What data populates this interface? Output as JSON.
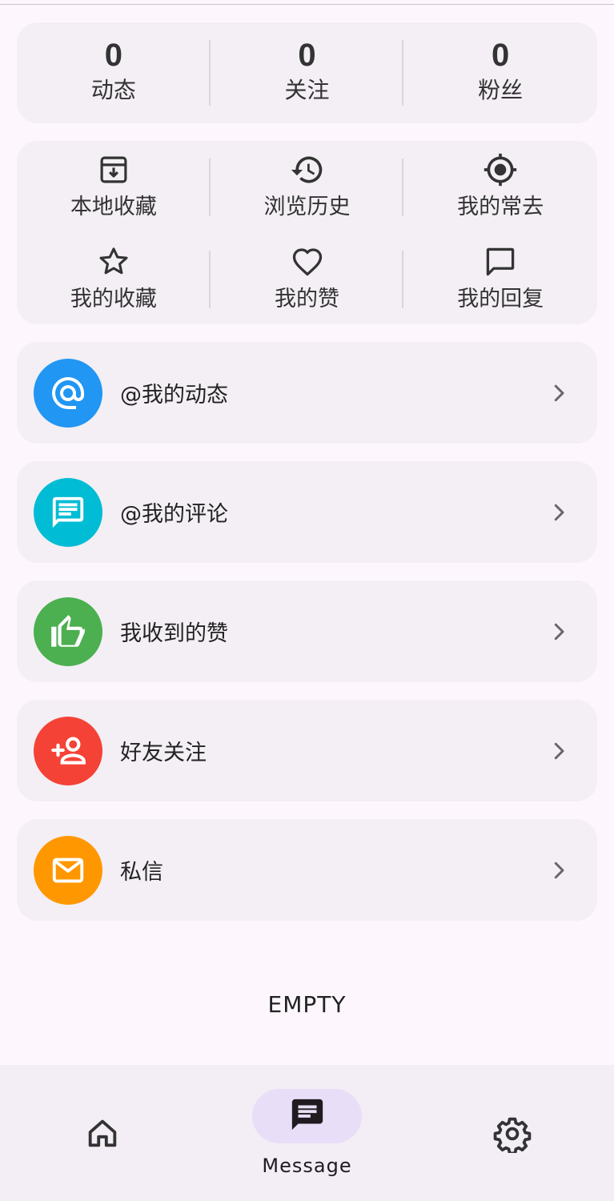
{
  "stats": [
    {
      "count": "0",
      "label": "动态"
    },
    {
      "count": "0",
      "label": "关注"
    },
    {
      "count": "0",
      "label": "粉丝"
    }
  ],
  "shortcuts": [
    {
      "icon": "archive-icon",
      "label": "本地收藏"
    },
    {
      "icon": "history-icon",
      "label": "浏览历史"
    },
    {
      "icon": "location-target-icon",
      "label": "我的常去"
    },
    {
      "icon": "star-icon",
      "label": "我的收藏"
    },
    {
      "icon": "heart-icon",
      "label": "我的赞"
    },
    {
      "icon": "comment-icon",
      "label": "我的回复"
    }
  ],
  "messages": [
    {
      "icon": "at-sign-icon",
      "color": "#2196f3",
      "label": "@我的动态"
    },
    {
      "icon": "message-icon",
      "color": "#00bcd4",
      "label": "@我的评论"
    },
    {
      "icon": "thumb-up-icon",
      "color": "#4caf50",
      "label": "我收到的赞"
    },
    {
      "icon": "person-add-icon",
      "color": "#f44336",
      "label": "好友关注"
    },
    {
      "icon": "mail-icon",
      "color": "#ff9800",
      "label": "私信"
    }
  ],
  "empty_text": "EMPTY",
  "nav": {
    "active": "Message",
    "items": [
      {
        "icon": "home-icon",
        "label": ""
      },
      {
        "icon": "chat-icon",
        "label": "Message"
      },
      {
        "icon": "gear-icon",
        "label": ""
      }
    ]
  }
}
